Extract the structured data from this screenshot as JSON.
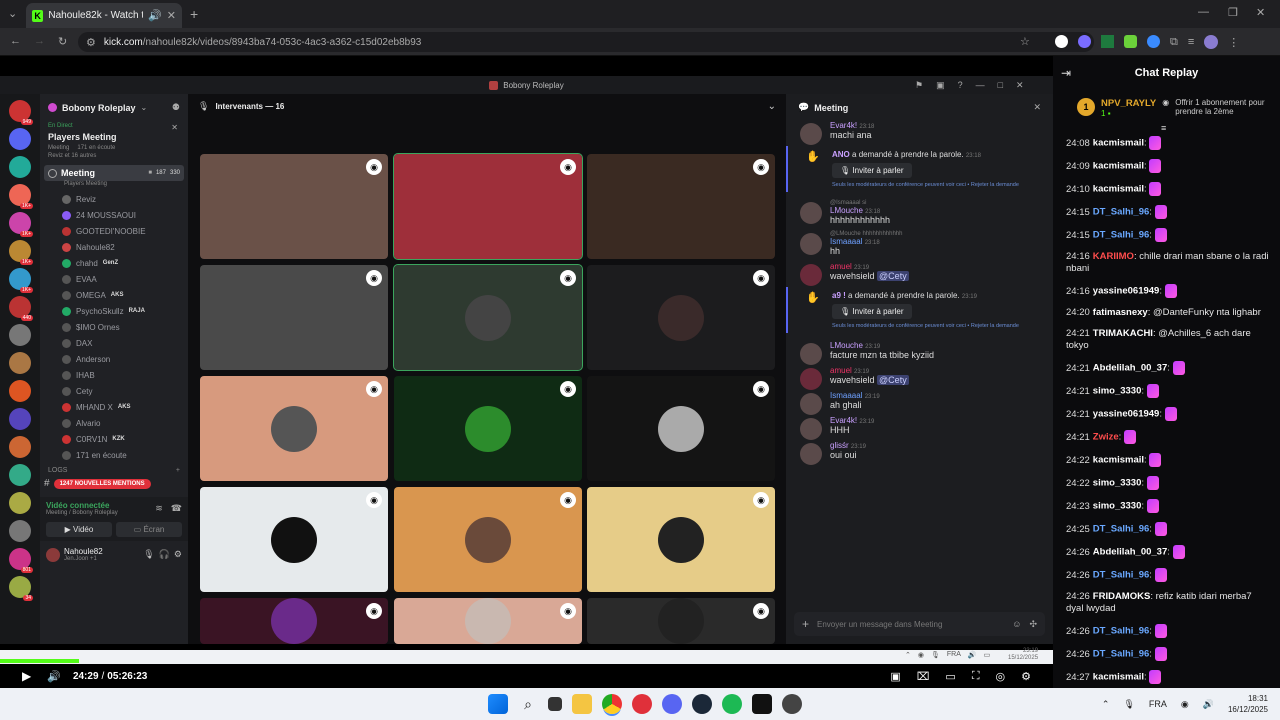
{
  "browser": {
    "tab_title": "Nahoule82k - Watch the VO",
    "url_domain": "kick.com",
    "url_path": "/nahoule82k/videos/8943ba74-053c-4ac3-a362-c15d02eb8b93"
  },
  "discord": {
    "window_title": "Bobony Roleplay",
    "server_name": "Bobony Roleplay",
    "live_label": "En Direct",
    "stage_title": "Players Meeting",
    "stage_sub": "Meeting",
    "stage_listeners": "171 en écoute",
    "stage_extra": "Reviz et 16 autres",
    "channel_name": "Meeting",
    "channel_count1": "187",
    "channel_count2": "330",
    "channel_sub": "Players Meeting",
    "members": [
      "Reviz",
      "24 MOUSSAOUI",
      "GOOTEDI'NOOBIE",
      "Nahoule82",
      "chahd",
      "EVAA",
      "OMEGA",
      "PsychoSkullz",
      "$IMO Ornes",
      "DAX",
      "Anderson",
      "IHAB",
      "Cety",
      "MHAND X",
      "Alvario",
      "C0RV1N",
      "171 en écoute"
    ],
    "member_badges": {
      "chahd": "GenZ",
      "OMEGA": "AKS",
      "PsychoSkullz": "RAJA",
      "MHAND X": "AKS",
      "C0RV1N": "KZK"
    },
    "logs_label": "LOGS",
    "mentions": "1247 NOUVELLES MENTIONS",
    "nouveau": "NOUVEAU",
    "video_connected": "Vidéo connectée",
    "video_connected_sub": "Meeting / Bobony Roleplay",
    "btn_video": "Vidéo",
    "btn_screen": "Écran",
    "user_name": "Nahoule82",
    "user_sub": "Jen.Joon +1",
    "speakers_label": "Intervenants — 16",
    "server_badges": [
      "949",
      "",
      "",
      "1K+",
      "1K+",
      "1K+",
      "1K+",
      "440",
      "",
      "",
      "",
      "",
      "",
      "",
      "",
      "",
      "801",
      "34"
    ],
    "chat_input_placeholder": "Envoyer un message dans Meeting",
    "chat": [
      {
        "type": "msg",
        "user": "Evar4k!",
        "time": "23:18",
        "text": "machi ana",
        "color": "#c9a0ff"
      },
      {
        "type": "req",
        "user": "ANO",
        "text": "a demandé à prendre la parole.",
        "time": "23:18",
        "invite": "Inviter à parler",
        "note": "Seuls les modérateurs de conférence peuvent voir ceci • Rejeter la demande"
      },
      {
        "type": "reply",
        "reply": "@Ismaaaal si",
        "user": "LMouche",
        "time": "23:18",
        "text": "hhhhhhhhhhhh",
        "color": "#c9a0ff"
      },
      {
        "type": "reply",
        "reply": "@LMouche hhhhhhhhhhhh",
        "user": "Ismaaaal",
        "time": "23:18",
        "text": "hh",
        "color": "#6ea0ff"
      },
      {
        "type": "msg",
        "user": "amuel",
        "time": "23:19",
        "text": "wavehsield",
        "mention": "@Cety",
        "color": "#e36"
      },
      {
        "type": "req",
        "user": "a9 !",
        "text": "a demandé à prendre la parole.",
        "time": "23:19",
        "invite": "Inviter à parler",
        "note": "Seuls les modérateurs de conférence peuvent voir ceci • Rejeter la demande"
      },
      {
        "type": "msg",
        "user": "LMouche",
        "time": "23:19",
        "text": "facture mzn ta tbibe kyziid",
        "color": "#c9a0ff"
      },
      {
        "type": "msg",
        "user": "amuel",
        "time": "23:19",
        "text": "wavehsield",
        "mention": "@Cety",
        "color": "#e36"
      },
      {
        "type": "msg",
        "user": "Ismaaaal",
        "time": "23:19",
        "text": "ah ghali",
        "color": "#6ea0ff"
      },
      {
        "type": "msg",
        "user": "Evar4k!",
        "time": "23:19",
        "text": "HHH",
        "color": "#c9a0ff"
      },
      {
        "type": "msg",
        "user": "glisśr",
        "time": "23:19",
        "text": "oui oui",
        "color": "#c9a0ff"
      }
    ]
  },
  "player": {
    "time_current": "24:29",
    "time_total": "05:26:23",
    "tray_lang": "FRA",
    "tray_time": "23:19",
    "tray_date": "15/12/2025",
    "progress_fraction": 0.075
  },
  "kick_chat": {
    "title": "Chat Replay",
    "pinned_user": "NPV_RAYLY",
    "pinned_rank": "1",
    "pinned_count": "1",
    "pinned_text": "Offrir 1 abonnement pour prendre la 2ème",
    "messages": [
      {
        "time": "24:08",
        "user": "kacmismail",
        "text": "",
        "color": "#ffffff",
        "emote": true
      },
      {
        "time": "24:09",
        "user": "kacmismail",
        "text": "",
        "color": "#ffffff",
        "emote": true
      },
      {
        "time": "24:10",
        "user": "kacmismail",
        "text": "",
        "color": "#ffffff",
        "emote": true
      },
      {
        "time": "24:15",
        "user": "DT_Salhi_96",
        "text": "",
        "color": "#6aa8ff",
        "emote": true
      },
      {
        "time": "24:15",
        "user": "DT_Salhi_96",
        "text": "",
        "color": "#6aa8ff",
        "emote": true
      },
      {
        "time": "24:16",
        "user": "KARIIMO",
        "text": "chille drari man sbane o la radi nbani",
        "color": "#ff4d4d",
        "emote": false
      },
      {
        "time": "24:16",
        "user": "yassine061949",
        "text": "",
        "color": "#ffffff",
        "emote": true
      },
      {
        "time": "24:20",
        "user": "fatimasnexy",
        "text": "@DanteFunky nta lighabr",
        "color": "#ffffff",
        "emote": false
      },
      {
        "time": "24:21",
        "user": "TRIMAKACHI",
        "text": "@Achilles_6 ach dare tokyo",
        "color": "#ffffff",
        "emote": false
      },
      {
        "time": "24:21",
        "user": "Abdelilah_00_37",
        "text": "",
        "color": "#ffffff",
        "emote": true
      },
      {
        "time": "24:21",
        "user": "simo_3330",
        "text": "",
        "color": "#ffffff",
        "emote": true
      },
      {
        "time": "24:21",
        "user": "yassine061949",
        "text": "",
        "color": "#ffffff",
        "emote": true
      },
      {
        "time": "24:21",
        "user": "Zwize",
        "text": "",
        "color": "#ff4d4d",
        "emote": true
      },
      {
        "time": "24:22",
        "user": "kacmismail",
        "text": "",
        "color": "#ffffff",
        "emote": true
      },
      {
        "time": "24:22",
        "user": "simo_3330",
        "text": "",
        "color": "#ffffff",
        "emote": true
      },
      {
        "time": "24:23",
        "user": "simo_3330",
        "text": "",
        "color": "#ffffff",
        "emote": true
      },
      {
        "time": "24:25",
        "user": "DT_Salhi_96",
        "text": "",
        "color": "#6aa8ff",
        "emote": true
      },
      {
        "time": "24:26",
        "user": "Abdelilah_00_37",
        "text": "",
        "color": "#ffffff",
        "emote": true
      },
      {
        "time": "24:26",
        "user": "DT_Salhi_96",
        "text": "",
        "color": "#6aa8ff",
        "emote": true
      },
      {
        "time": "24:26",
        "user": "FRIDAMOKS",
        "text": "refiz katib idari merba7 dyal lwydad",
        "color": "#ffffff",
        "emote": false
      },
      {
        "time": "24:26",
        "user": "DT_Salhi_96",
        "text": "",
        "color": "#6aa8ff",
        "emote": true
      },
      {
        "time": "24:26",
        "user": "DT_Salhi_96",
        "text": "",
        "color": "#6aa8ff",
        "emote": true
      },
      {
        "time": "24:27",
        "user": "kacmismail",
        "text": "",
        "color": "#ffffff",
        "emote": true
      },
      {
        "time": "24:29",
        "user": "Abdelilah_00_37",
        "text": "",
        "color": "#ffffff",
        "emote": true
      }
    ]
  },
  "taskbar": {
    "lang": "FRA",
    "time": "18:31",
    "date": "16/12/2025"
  },
  "colors": {
    "kick_green": "#53fc18",
    "discord_bg": "#1e1f22",
    "accent_blurple": "#5865f2",
    "mention_red": "#e0303a"
  }
}
